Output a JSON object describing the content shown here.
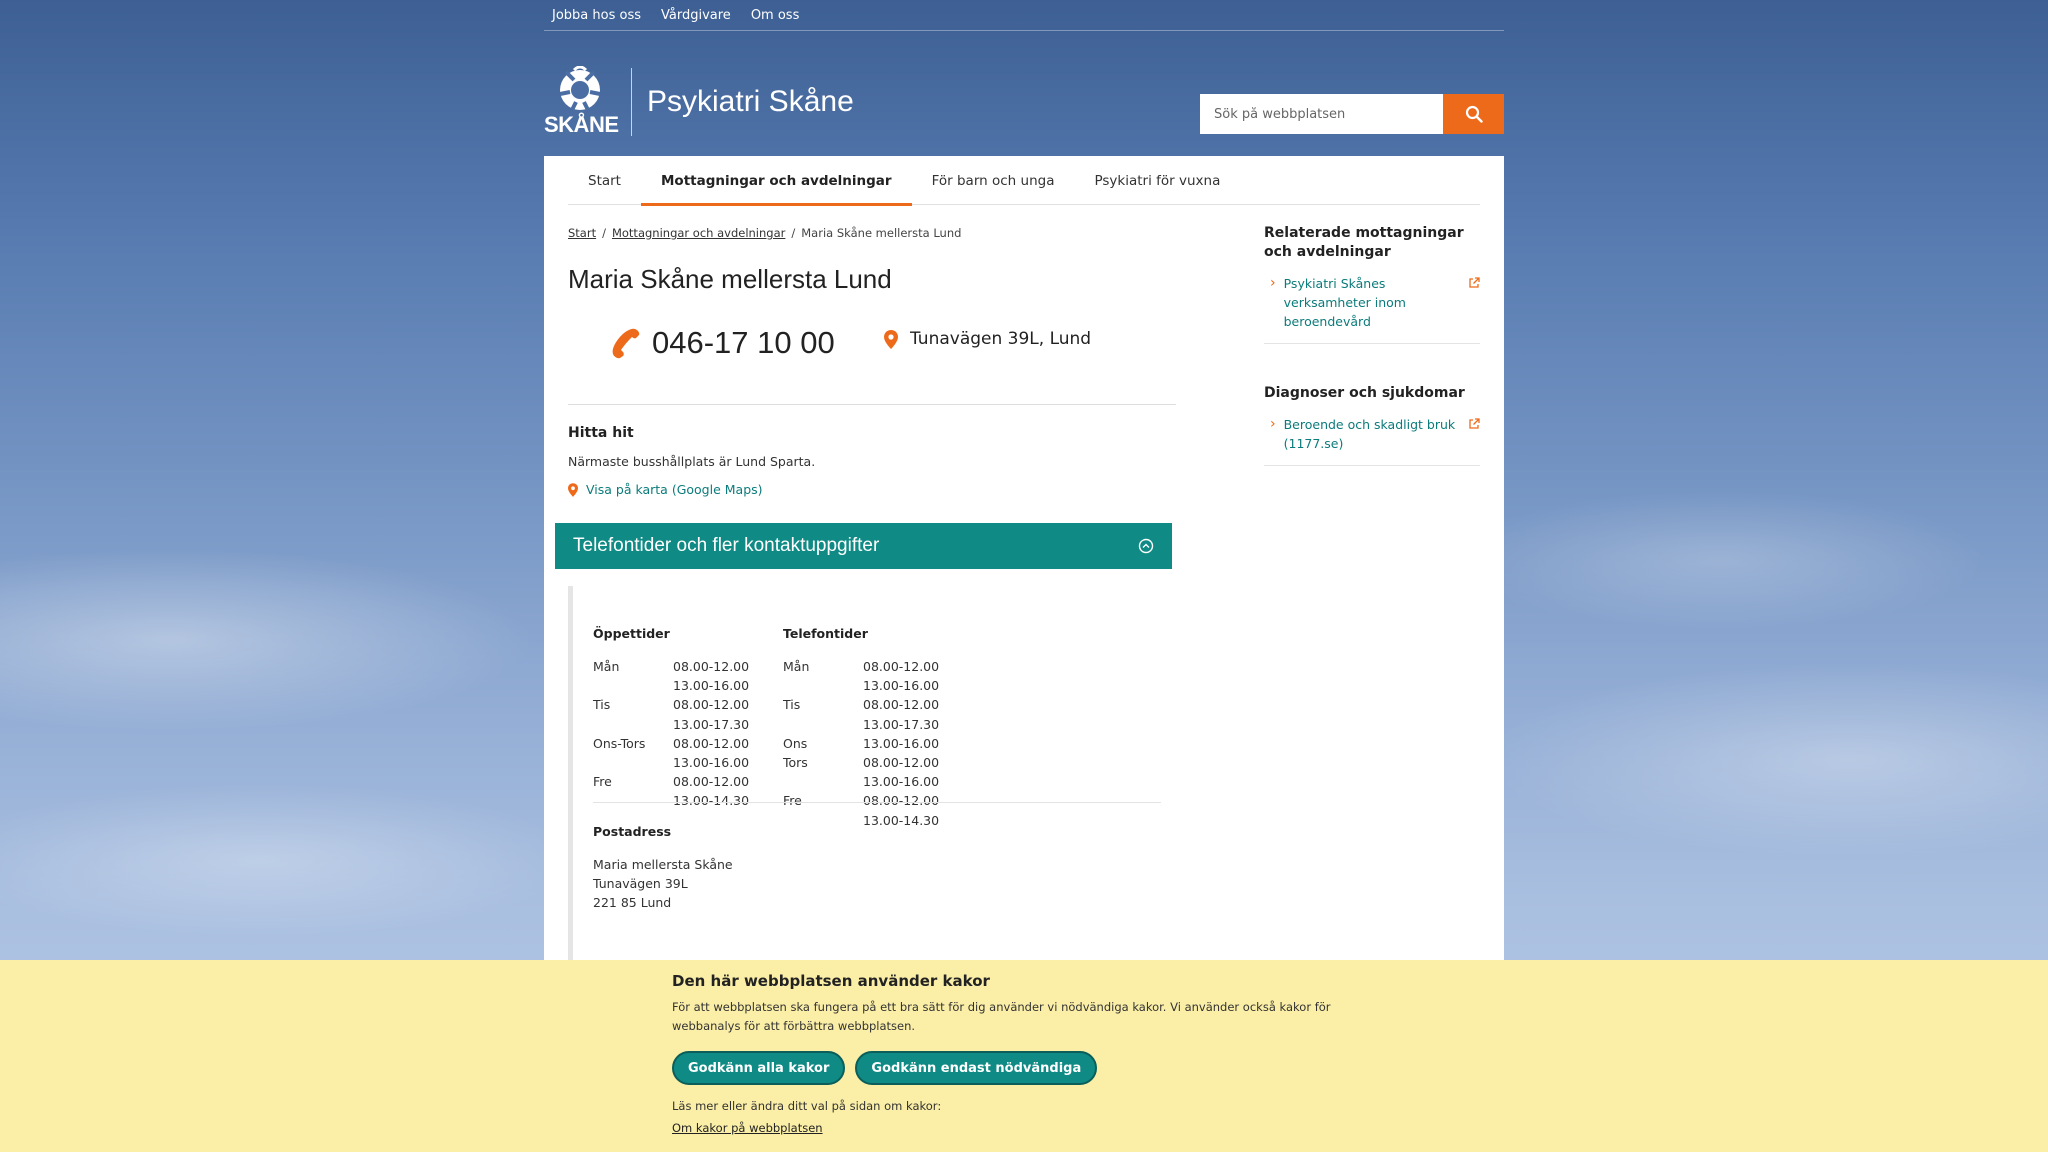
{
  "utility_nav": [
    "Jobba hos oss",
    "Vårdgivare",
    "Om oss"
  ],
  "header": {
    "logo_text": "SKÅNE",
    "site_title": "Psykiatri Skåne",
    "search_placeholder": "Sök på webbplatsen"
  },
  "main_nav": [
    {
      "label": "Start",
      "active": false
    },
    {
      "label": "Mottagningar och avdelningar",
      "active": true
    },
    {
      "label": "För barn och unga",
      "active": false
    },
    {
      "label": "Psykiatri för vuxna",
      "active": false
    }
  ],
  "breadcrumb": [
    "Start",
    "Mottagningar och avdelningar",
    "Maria Skåne mellersta Lund"
  ],
  "page_title": "Maria Skåne mellersta Lund",
  "contact": {
    "phone": "046-17 10 00",
    "address": "Tunavägen 39L, Lund"
  },
  "directions": {
    "heading": "Hitta hit",
    "text": "Närmaste busshållplats är Lund Sparta.",
    "map_link": "Visa på karta (Google Maps)"
  },
  "accordion": {
    "title": "Telefontider och fler kontaktuppgifter"
  },
  "opening_hours": {
    "heading": "Öppettider",
    "rows": [
      {
        "day": "Mån",
        "time": "08.00-12.00"
      },
      {
        "day": "",
        "time": "13.00-16.00"
      },
      {
        "day": "Tis",
        "time": "08.00-12.00"
      },
      {
        "day": "",
        "time": "13.00-17.30"
      },
      {
        "day": "Ons-Tors",
        "time": "08.00-12.00"
      },
      {
        "day": "",
        "time": "13.00-16.00"
      },
      {
        "day": "Fre",
        "time": "08.00-12.00"
      },
      {
        "day": "",
        "time": "13.00-14.30"
      }
    ]
  },
  "phone_hours": {
    "heading": "Telefontider",
    "rows": [
      {
        "day": "Mån",
        "time": "08.00-12.00"
      },
      {
        "day": "",
        "time": "13.00-16.00"
      },
      {
        "day": "Tis",
        "time": "08.00-12.00"
      },
      {
        "day": "",
        "time": "13.00-17.30"
      },
      {
        "day": "Ons",
        "time": "13.00-16.00"
      },
      {
        "day": "Tors",
        "time": "08.00-12.00"
      },
      {
        "day": "",
        "time": "13.00-16.00"
      },
      {
        "day": "Fre",
        "time": "08.00-12.00"
      },
      {
        "day": "",
        "time": "13.00-14.30"
      }
    ]
  },
  "postal_address": {
    "heading": "Postadress",
    "lines": [
      "Maria mellersta Skåne",
      "Tunavägen 39L",
      "221 85 Lund"
    ]
  },
  "sidebar": {
    "related": {
      "heading": "Relaterade mottagningar och avdelningar",
      "links": [
        "Psykiatri Skånes verksamheter inom beroendevård"
      ]
    },
    "diagnoses": {
      "heading": "Diagnoser och sjukdomar",
      "links": [
        "Beroende och skadligt bruk (1177.se)"
      ]
    }
  },
  "cookie_banner": {
    "heading": "Den här webbplatsen använder kakor",
    "text": "För att webbplatsen ska fungera på ett bra sätt för dig använder vi nödvändiga kakor. Vi använder också kakor för webbanalys för att förbättra webbplatsen.",
    "accept_all": "Godkänn alla kakor",
    "accept_necessary": "Godkänn endast nödvändiga",
    "more_text": "Läs mer eller ändra ditt val på sidan om kakor:",
    "more_link": "Om kakor på webbplatsen"
  },
  "colors": {
    "accent_orange": "#ee6a1b",
    "teal": "#0f8a84",
    "cookie_bg": "#fbefa7"
  }
}
